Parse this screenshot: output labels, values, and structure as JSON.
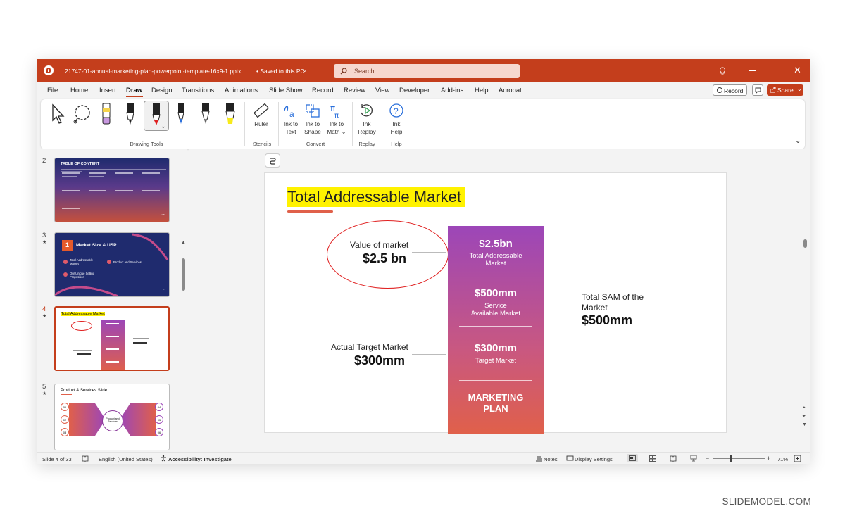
{
  "window": {
    "filename": "21747-01-annual-marketing-plan-powerpoint-template-16x9-1.pptx",
    "save_status": "• Saved to this PC",
    "search_placeholder": "Search"
  },
  "menu": [
    "File",
    "Home",
    "Insert",
    "Draw",
    "Design",
    "Transitions",
    "Animations",
    "Slide Show",
    "Record",
    "Review",
    "View",
    "Developer",
    "Add-ins",
    "Help",
    "Acrobat"
  ],
  "menu_active": "Draw",
  "menu_right": {
    "record": "Record",
    "share": "Share"
  },
  "ribbon": {
    "ruler": "Ruler",
    "ink_to_text": [
      "Ink to",
      "Text"
    ],
    "ink_to_shape": [
      "Ink to",
      "Shape"
    ],
    "ink_to_math": [
      "Ink to",
      "Math"
    ],
    "ink_replay": [
      "Ink",
      "Replay"
    ],
    "ink_help": [
      "Ink",
      "Help"
    ],
    "groups": {
      "drawing_tools": "Drawing Tools",
      "stencils": "Stencils",
      "convert": "Convert",
      "replay": "Replay",
      "help": "Help"
    }
  },
  "thumbnails": [
    {
      "num": "2",
      "star": "",
      "title": "TABLE OF CONTENT"
    },
    {
      "num": "3",
      "star": "★",
      "title": "Market Size & USP",
      "badge": "1",
      "items": [
        "Total Addressable Market",
        "Product and Services",
        "Our Unique Selling Proposition"
      ]
    },
    {
      "num": "4",
      "star": "★",
      "title": "Total Addressable Market"
    },
    {
      "num": "5",
      "star": "★",
      "title": "Product & Services Slide",
      "center": "Product and Services",
      "nums": [
        "01",
        "02",
        "03",
        "04",
        "05",
        "06"
      ]
    }
  ],
  "slide": {
    "title": "Total Addressable Market",
    "value_label": "Value of market",
    "value": "$2.5 bn",
    "target_label": "Actual Target Market",
    "target_value": "$300mm",
    "sam_label_1": "Total SAM of the",
    "sam_label_2": "Market",
    "sam_value": "$500mm",
    "col": [
      {
        "big": "$2.5bn",
        "small1": "Total Addressable",
        "small2": "Market"
      },
      {
        "big": "$500mm",
        "small1": "Service",
        "small2": "Available Market"
      },
      {
        "big": "$300mm",
        "small1": "Target Market",
        "small2": ""
      },
      {
        "big": "MARKETING",
        "small1": "PLAN",
        "small2": ""
      }
    ]
  },
  "status": {
    "slide_count": "Slide 4 of 33",
    "language": "English (United States)",
    "accessibility": "Accessibility: Investigate",
    "notes": "Notes",
    "display": "Display Settings",
    "zoom": "71%"
  },
  "colors": {
    "titlebar": "#c43e1c",
    "accent": "#c43e1c",
    "highlight": "#fff200",
    "gradient_top": "#9c46b8",
    "gradient_bottom": "#e0604a",
    "navy": "#1f2b6e"
  },
  "watermark": "SLIDEMODEL.COM"
}
